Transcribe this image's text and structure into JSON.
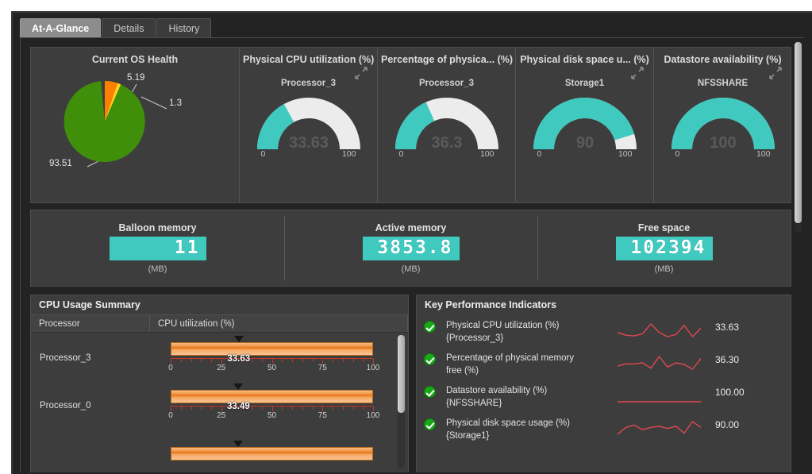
{
  "tabs": [
    {
      "label": "At-A-Glance",
      "active": true
    },
    {
      "label": "Details",
      "active": false
    },
    {
      "label": "History",
      "active": false
    }
  ],
  "colors": {
    "accent_teal": "#3fc9bf",
    "gauge_track": "#ececec",
    "pie_green": "#3f8f0a",
    "pie_orange": "#ff7f00",
    "pie_yellow": "#ffd21e",
    "bar_orange": "#e8751a",
    "axis_red": "#c0392b",
    "ok_green": "#18a818",
    "panel_bg": "#3d3d3d",
    "window_bg": "#232323"
  },
  "gauges_panel": {
    "pie": {
      "title": "Current OS Health",
      "type": "pie",
      "slices": [
        {
          "label": "93.51",
          "value": 93.51,
          "color": "#3f8f0a"
        },
        {
          "label": "5.19",
          "value": 5.19,
          "color": "#ff7f00"
        },
        {
          "label": "1.3",
          "value": 1.3,
          "color": "#ffd21e"
        }
      ]
    },
    "gauges": [
      {
        "title": "Physical CPU utilization (%)",
        "subject": "Processor_3",
        "value": "33.63",
        "value_num": 33.63,
        "min": "0",
        "max": "100",
        "expand_icon": "expand-icon"
      },
      {
        "title": "Percentage of physica... (%)",
        "subject": "Processor_3",
        "value": "36.3",
        "value_num": 36.3,
        "min": "0",
        "max": "100",
        "expand_icon": "expand-icon"
      },
      {
        "title": "Physical disk space u... (%)",
        "subject": "Storage1",
        "value": "90",
        "value_num": 90,
        "min": "0",
        "max": "100",
        "expand_icon": "expand-icon"
      },
      {
        "title": "Datastore availability (%)",
        "subject": "NFSSHARE",
        "value": "100",
        "value_num": 100,
        "min": "0",
        "max": "100",
        "expand_icon": "expand-icon"
      }
    ]
  },
  "memory_panel": {
    "cells": [
      {
        "title": "Balloon memory",
        "value": "11",
        "unit": "(MB)"
      },
      {
        "title": "Active memory",
        "value": "3853.8",
        "unit": "(MB)"
      },
      {
        "title": "Free space",
        "value": "102394",
        "unit": "(MB)"
      }
    ]
  },
  "cpu_panel": {
    "title": "CPU Usage Summary",
    "columns": [
      "Processor",
      "CPU utilization (%)"
    ],
    "axis_labels": [
      "0",
      "25",
      "50",
      "75",
      "100"
    ],
    "rows": [
      {
        "processor": "Processor_3",
        "value": "33.63",
        "value_num": 33.63
      },
      {
        "processor": "Processor_0",
        "value": "33.49",
        "value_num": 33.49
      },
      {
        "processor": "",
        "value": "",
        "value_num": 33.2
      }
    ]
  },
  "kpi_panel": {
    "title": "Key Performance Indicators",
    "rows": [
      {
        "status": "ok",
        "label": "Physical CPU utilization (%)",
        "subject": "{Processor_3}",
        "value": "33.63",
        "spark": [
          36,
          32,
          31,
          34,
          48,
          36,
          30,
          33,
          46,
          30,
          42
        ]
      },
      {
        "status": "ok",
        "label": "Percentage of physical memory",
        "subject": "free (%)",
        "value": "36.30",
        "spark": [
          30,
          34,
          34,
          36,
          26,
          48,
          28,
          36,
          33,
          24,
          44
        ]
      },
      {
        "status": "ok",
        "label": "Datastore availability (%)",
        "subject": "{NFSSHARE}",
        "value": "100.00",
        "spark": [
          34,
          34,
          34,
          34,
          34,
          34,
          34,
          34,
          34,
          34,
          34
        ]
      },
      {
        "status": "ok",
        "label": "Physical disk space usage (%)",
        "subject": "{Storage1}",
        "value": "90.00",
        "spark": [
          30,
          36,
          38,
          34,
          36,
          37,
          35,
          37,
          31,
          41,
          36
        ]
      }
    ]
  },
  "chart_data": [
    {
      "type": "pie",
      "title": "Current OS Health",
      "categories": [
        "93.51",
        "5.19",
        "1.3"
      ],
      "values": [
        93.51,
        5.19,
        1.3
      ],
      "colors": [
        "#3f8f0a",
        "#ff7f00",
        "#ffd21e"
      ],
      "legend": "none",
      "labels_shown": true
    },
    {
      "type": "gauge",
      "title": "Physical CPU utilization (%)",
      "subtitle": "Processor_3",
      "values": [
        33.63
      ],
      "ylim": [
        0,
        100
      ],
      "tick_labels": [
        "0",
        "100"
      ]
    },
    {
      "type": "gauge",
      "title": "Percentage of physica... (%)",
      "subtitle": "Processor_3",
      "values": [
        36.3
      ],
      "ylim": [
        0,
        100
      ],
      "tick_labels": [
        "0",
        "100"
      ]
    },
    {
      "type": "gauge",
      "title": "Physical disk space u... (%)",
      "subtitle": "Storage1",
      "values": [
        90
      ],
      "ylim": [
        0,
        100
      ],
      "tick_labels": [
        "0",
        "100"
      ]
    },
    {
      "type": "gauge",
      "title": "Datastore availability (%)",
      "subtitle": "NFSSHARE",
      "values": [
        100
      ],
      "ylim": [
        0,
        100
      ],
      "tick_labels": [
        "0",
        "100"
      ]
    },
    {
      "type": "bar",
      "title": "CPU Usage Summary",
      "xlabel": "CPU utilization (%)",
      "ylabel": "Processor",
      "categories": [
        "Processor_3",
        "Processor_0"
      ],
      "values": [
        33.63,
        33.49
      ],
      "xlim": [
        0,
        100
      ],
      "tick_labels": [
        "0",
        "25",
        "50",
        "75",
        "100"
      ],
      "grid": false
    },
    {
      "type": "line",
      "title": "Key Performance Indicators",
      "series": [
        {
          "name": "Physical CPU utilization (%) {Processor_3}",
          "values": [
            36,
            32,
            31,
            34,
            48,
            36,
            30,
            33,
            46,
            30,
            42
          ],
          "last": 33.63
        },
        {
          "name": "Percentage of physical memory free (%)",
          "values": [
            30,
            34,
            34,
            36,
            26,
            48,
            28,
            36,
            33,
            24,
            44
          ],
          "last": 36.3
        },
        {
          "name": "Datastore availability (%) {NFSSHARE}",
          "values": [
            34,
            34,
            34,
            34,
            34,
            34,
            34,
            34,
            34,
            34,
            34
          ],
          "last": 100.0
        },
        {
          "name": "Physical disk space usage (%) {Storage1}",
          "values": [
            30,
            36,
            38,
            34,
            36,
            37,
            35,
            37,
            31,
            41,
            36
          ],
          "last": 90.0
        }
      ],
      "legend": "none",
      "grid": false
    }
  ]
}
